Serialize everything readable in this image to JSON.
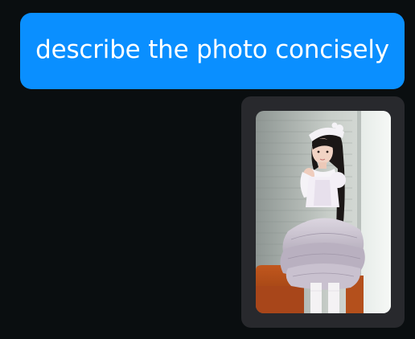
{
  "conversation": {
    "user_message": {
      "text": "describe the photo concisely"
    },
    "attachment": {
      "kind": "photo",
      "icon": "photo-thumbnail"
    }
  },
  "colors": {
    "background": "#0a0e10",
    "user_bubble": "#0a8fff",
    "user_text": "#ffffff",
    "attachment_card": "#28292d"
  }
}
